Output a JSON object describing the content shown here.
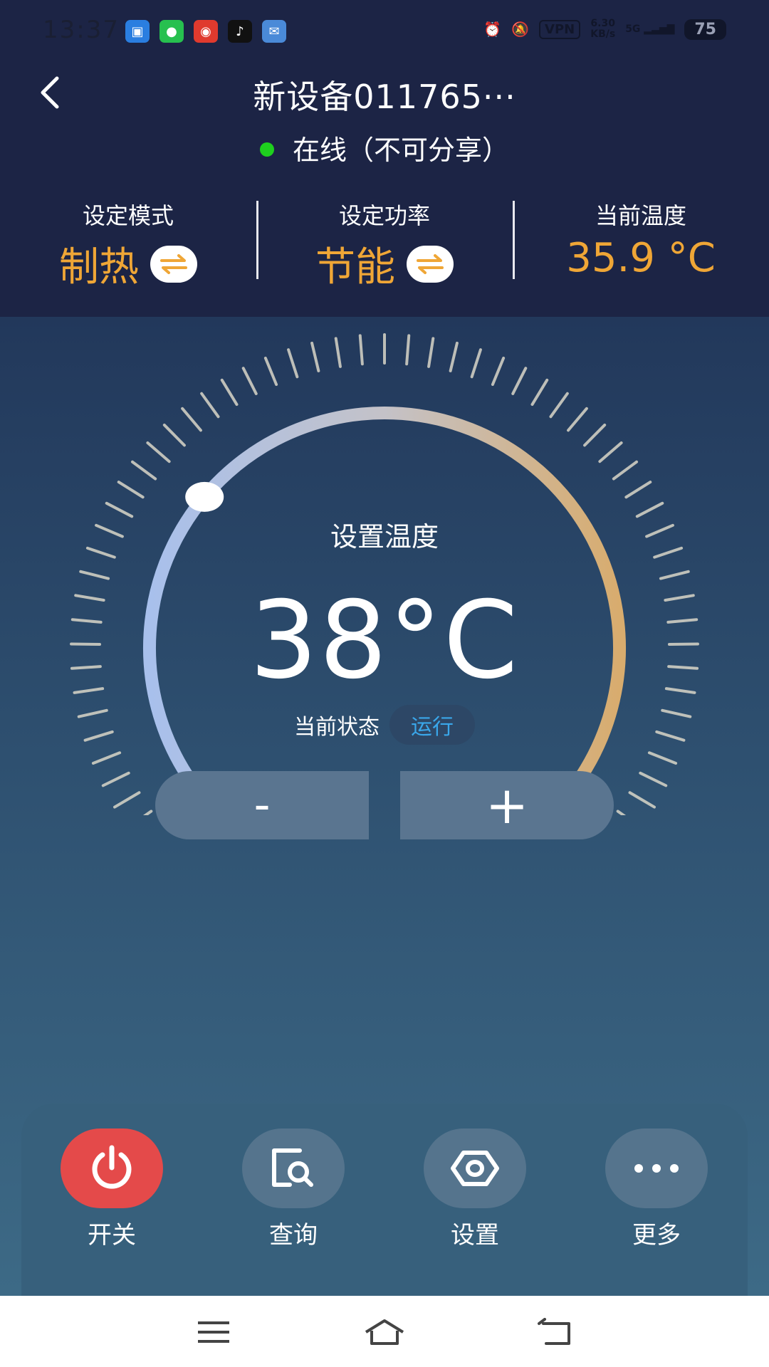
{
  "status_bar": {
    "time": "13:37",
    "vpn": "VPN",
    "net_speed_value": "6.30",
    "net_speed_unit": "KB/s",
    "signal": "5G",
    "battery": "75"
  },
  "header": {
    "title": "新设备011765···",
    "online_status": "在线（不可分享）",
    "online_color": "#1ed01e"
  },
  "stats": {
    "mode_label": "设定模式",
    "mode_value": "制热",
    "power_label": "设定功率",
    "power_value": "节能",
    "current_temp_label": "当前温度",
    "current_temp_value": "35.9 °C",
    "accent_color": "#efa636"
  },
  "dial": {
    "label": "设置温度",
    "set_temp": "38°C",
    "state_label": "当前状态",
    "state_value": "运行",
    "knob_fraction": 0.3
  },
  "controls": {
    "minus": "-",
    "plus": "+"
  },
  "toolbar": {
    "power_label": "开关",
    "query_label": "查询",
    "settings_label": "设置",
    "more_label": "更多",
    "power_color": "#e44a4a"
  }
}
